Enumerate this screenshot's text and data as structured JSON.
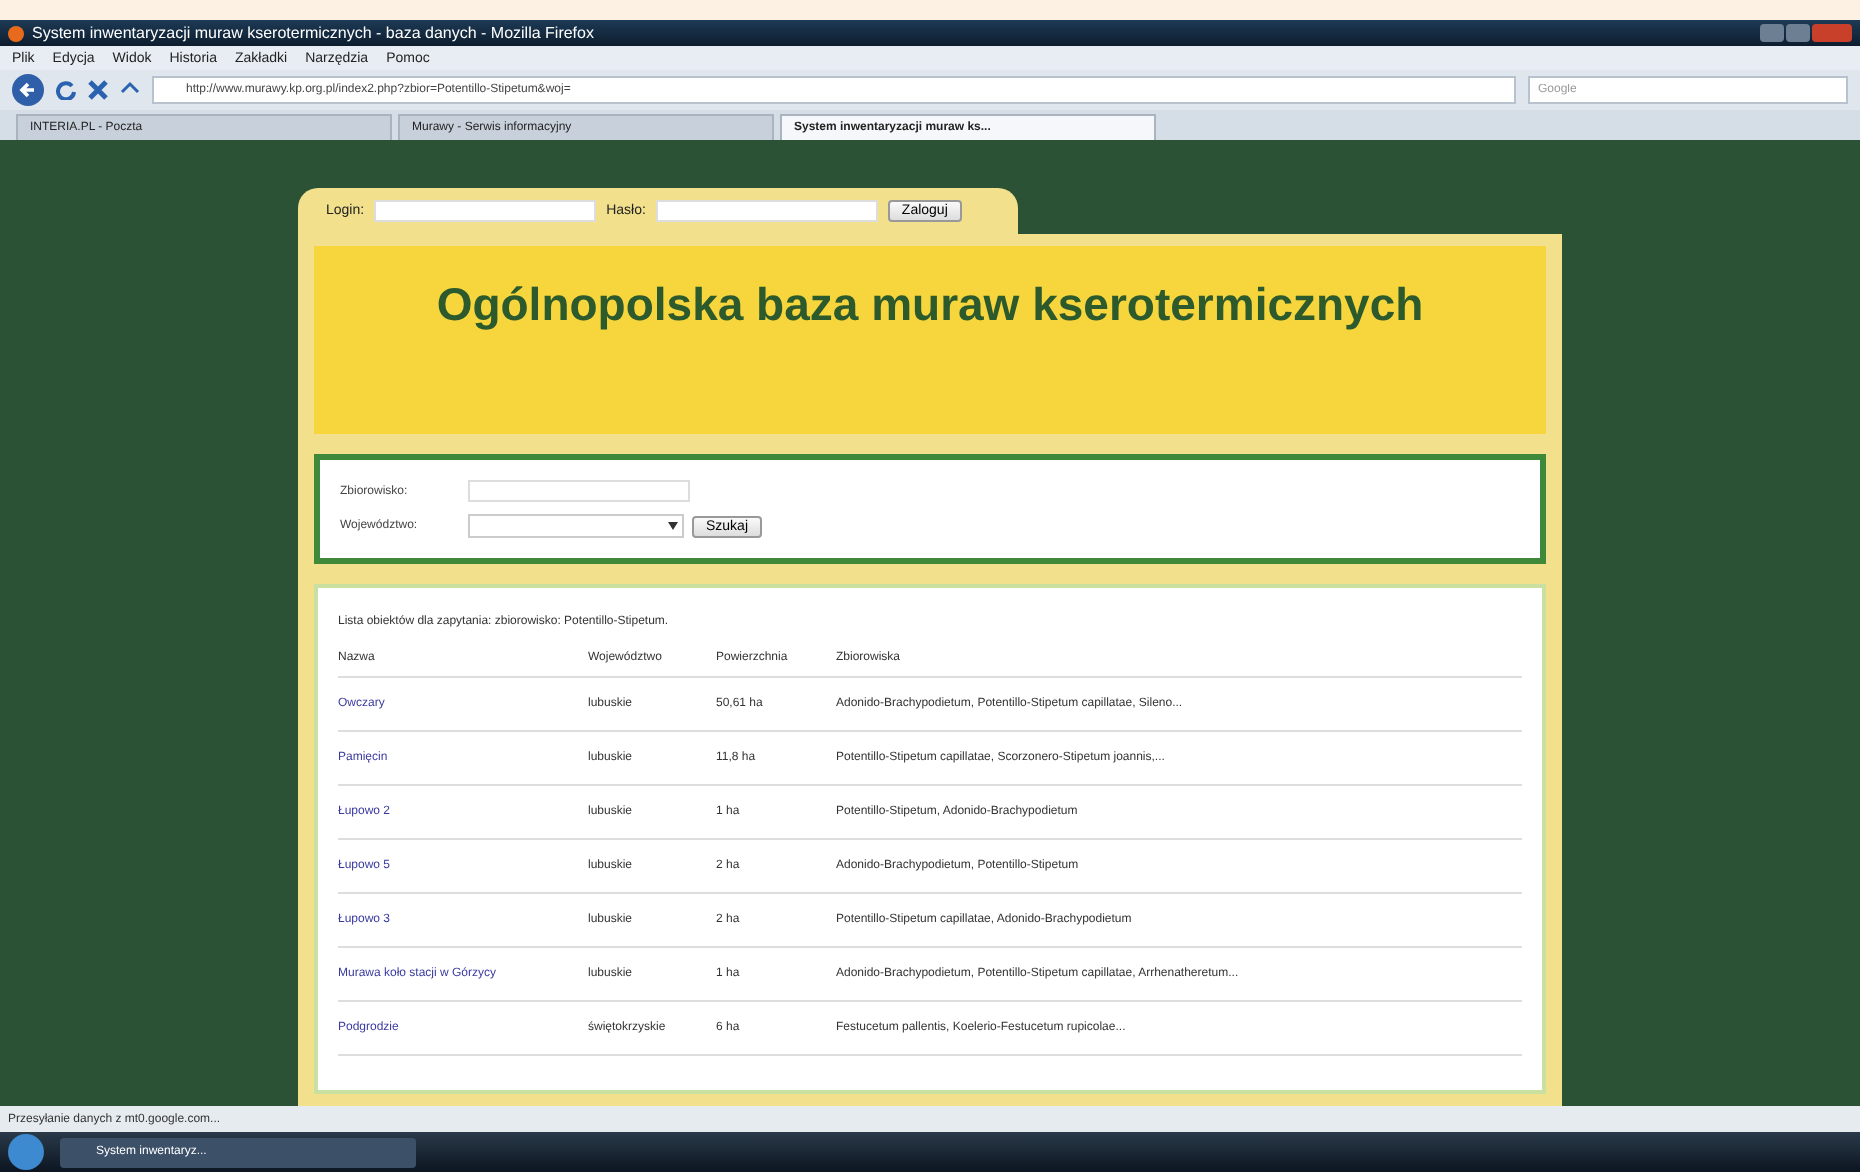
{
  "window": {
    "title": "System inwentaryzacji muraw kserotermicznych - baza danych - Mozilla Firefox"
  },
  "menu": [
    "Plik",
    "Edycja",
    "Widok",
    "Historia",
    "Zakładki",
    "Narzędzia",
    "Pomoc"
  ],
  "address": {
    "url": "http://www.murawy.kp.org.pl/index2.php?zbior=Potentillo-Stipetum&woj="
  },
  "search": {
    "placeholder": "Google"
  },
  "tabs": [
    {
      "label": "INTERIA.PL - Poczta",
      "selected": false
    },
    {
      "label": "Murawy - Serwis informacyjny",
      "selected": false
    },
    {
      "label": "System inwentaryzacji muraw ks...",
      "selected": true
    }
  ],
  "login": {
    "login_label": "Login:",
    "password_label": "Hasło:",
    "button": "Zaloguj"
  },
  "header": {
    "title": "Ogólnopolska baza muraw kserotermicznych"
  },
  "search_form": {
    "community_label": "Zbiorowisko:",
    "province_label": "Województwo:",
    "button": "Szukaj"
  },
  "results": {
    "caption": "Lista obiektów dla zapytania: zbiorowisko: Potentillo-Stipetum.",
    "columns": [
      "Nazwa",
      "Województwo",
      "Powierzchnia",
      "Zbiorowiska"
    ],
    "rows": [
      {
        "name": "Owczary",
        "province": "lubuskie",
        "area": "50,61 ha",
        "communities": "Adonido-Brachypodietum, Potentillo-Stipetum capillatae, Sileno..."
      },
      {
        "name": "Pamięcin",
        "province": "lubuskie",
        "area": "11,8 ha",
        "communities": "Potentillo-Stipetum capillatae, Scorzonero-Stipetum joannis,..."
      },
      {
        "name": "Łupowo 2",
        "province": "lubuskie",
        "area": "1 ha",
        "communities": "Potentillo-Stipetum, Adonido-Brachypodietum"
      },
      {
        "name": "Łupowo 5",
        "province": "lubuskie",
        "area": "2 ha",
        "communities": "Adonido-Brachypodietum, Potentillo-Stipetum"
      },
      {
        "name": "Łupowo 3",
        "province": "lubuskie",
        "area": "2 ha",
        "communities": "Potentillo-Stipetum capillatae, Adonido-Brachypodietum"
      },
      {
        "name": "Murawa koło stacji w Górzycy",
        "province": "lubuskie",
        "area": "1 ha",
        "communities": "Adonido-Brachypodietum, Potentillo-Stipetum capillatae, Arrhenatheretum..."
      },
      {
        "name": "Podgrodzie",
        "province": "świętokrzyskie",
        "area": "6 ha",
        "communities": "Festucetum pallentis, Koelerio-Festucetum rupicolae..."
      }
    ]
  },
  "status_bar": {
    "text": "Przesyłanie danych z mt0.google.com..."
  },
  "taskbar": {
    "items": [
      {
        "label": "System inwentaryz...",
        "selected": true
      }
    ]
  }
}
